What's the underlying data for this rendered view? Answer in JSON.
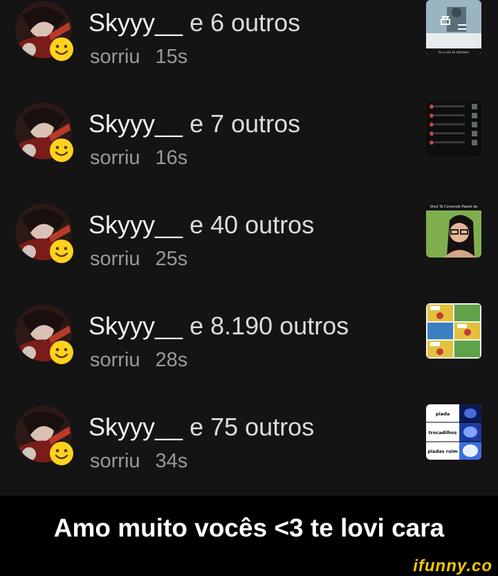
{
  "notifications": [
    {
      "user": "Skyyy__",
      "others": "e 6 outros",
      "action": "sorriu",
      "time": "15s",
      "thumb_text": "Eu e ele te afastam"
    },
    {
      "user": "Skyyy__",
      "others": "e 7 outros",
      "action": "sorriu",
      "time": "16s",
      "thumb_text": ""
    },
    {
      "user": "Skyyy__",
      "others": "e 40 outros",
      "action": "sorriu",
      "time": "25s",
      "thumb_text": "Você Tá Comendo Pastel de"
    },
    {
      "user": "Skyyy__",
      "others": "e 8.190 outros",
      "action": "sorriu",
      "time": "28s",
      "thumb_text": ""
    },
    {
      "user": "Skyyy__",
      "others": "e 75 outros",
      "action": "sorriu",
      "time": "34s",
      "thumb_lines": [
        "piada",
        "trocadilhos",
        "piadas ruim"
      ]
    }
  ],
  "caption": "Amo muito vocês <3 te lovi cara",
  "watermark": "ifunny.co",
  "icons": {
    "reaction": "smile-emoji-icon",
    "repost": "repost-icon"
  },
  "colors": {
    "background": "#141414",
    "reaction": "#ffd21f",
    "watermark": "#f3c800"
  }
}
